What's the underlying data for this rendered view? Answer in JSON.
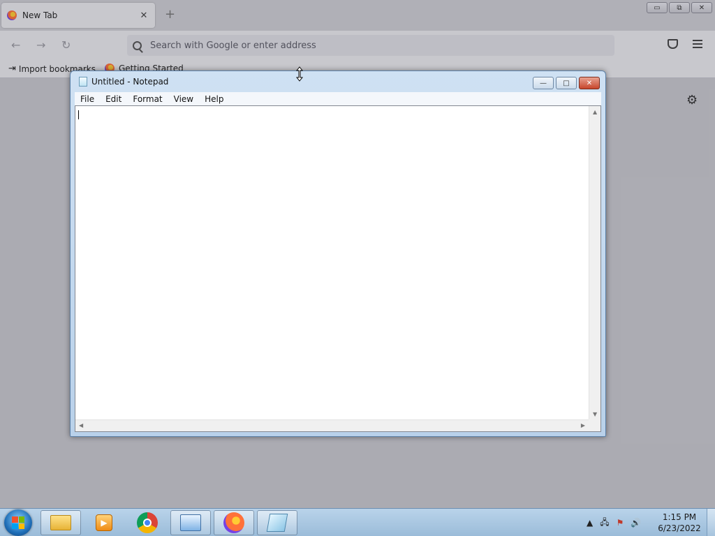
{
  "browser": {
    "tab_title": "New Tab",
    "tab_close": "✕",
    "new_tab": "+",
    "win_min": "▭",
    "win_restore": "⧉",
    "win_close": "✕",
    "nav_back": "←",
    "nav_forward": "→",
    "nav_reload": "↻",
    "url_placeholder": "Search with Google or enter address",
    "bookmarks": [
      {
        "label": "Import bookmarks...",
        "icon": "import-icon"
      },
      {
        "label": "Getting Started",
        "icon": "firefox-icon"
      }
    ],
    "gear_glyph": "⚙"
  },
  "notepad": {
    "title": "Untitled - Notepad",
    "btn_min": "—",
    "btn_max": "□",
    "btn_close": "✕",
    "menu": [
      "File",
      "Edit",
      "Format",
      "View",
      "Help"
    ],
    "text": "",
    "scroll_up": "▲",
    "scroll_down": "▼",
    "scroll_left": "◀",
    "scroll_right": "▶"
  },
  "taskbar": {
    "apps": [
      {
        "name": "windows-explorer",
        "icon": "folder-icon"
      },
      {
        "name": "media-player",
        "icon": "media-icon"
      },
      {
        "name": "chrome",
        "icon": "chrome-icon"
      },
      {
        "name": "remote-desktop",
        "icon": "remote-icon"
      },
      {
        "name": "firefox",
        "icon": "firefox-icon"
      },
      {
        "name": "notepad",
        "icon": "notepad-icon"
      }
    ],
    "tray_chevron": "▲",
    "tray_network": "🖧",
    "tray_flag": "⚑",
    "tray_volume": "🔊",
    "clock_time": "1:15 PM",
    "clock_date": "6/23/2022"
  },
  "colors": {
    "titlebar": "#b9d1ea",
    "taskbar": "#9bbcd9",
    "close_red": "#c7462c"
  }
}
